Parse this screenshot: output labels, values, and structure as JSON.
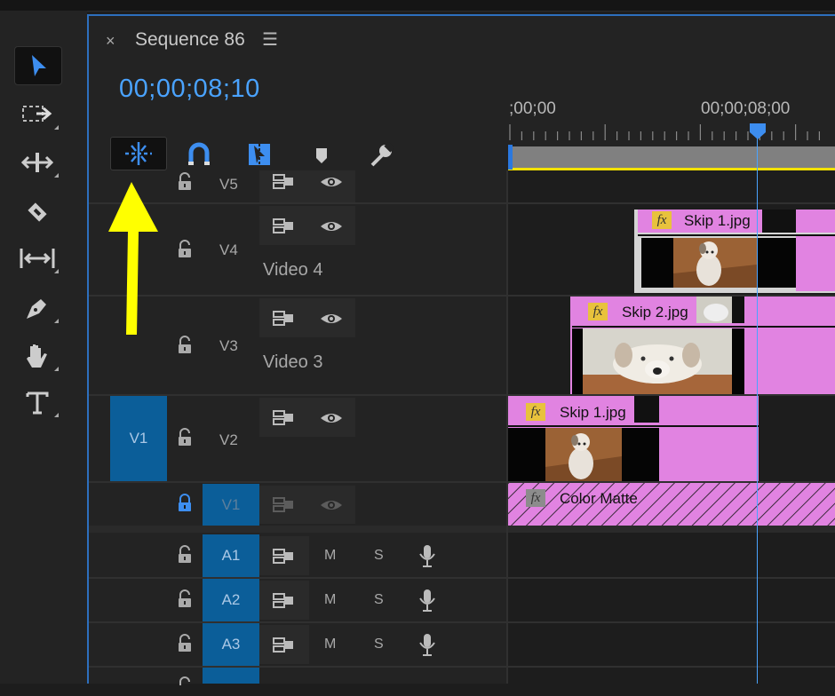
{
  "sequence": {
    "close_glyph": "×",
    "title": "Sequence 86",
    "menu_glyph": "☰",
    "timecode": "00;00;08;10"
  },
  "timeline_tools": [
    {
      "name": "snap-in-timeline-icon",
      "selected": true
    },
    {
      "name": "magnet-linked-selection-icon"
    },
    {
      "name": "insert-overwrite-icon"
    },
    {
      "name": "add-marker-icon"
    },
    {
      "name": "wrench-settings-icon"
    }
  ],
  "toolbar": [
    "selection-tool-icon",
    "track-select-forward-icon",
    "ripple-edit-icon",
    "razor-icon",
    "slip-icon",
    "pen-icon",
    "hand-icon",
    "type-icon"
  ],
  "ruler": {
    "start_label": ";00;00",
    "mark_label": "00;00;08;00"
  },
  "video_tracks": [
    {
      "id": "V5",
      "label": ""
    },
    {
      "id": "V4",
      "label": "Video 4"
    },
    {
      "id": "V3",
      "label": "Video 3"
    },
    {
      "id": "V2",
      "label": "",
      "source_patch": "V1"
    },
    {
      "id": "V1",
      "label": "",
      "locked": true
    }
  ],
  "audio_tracks": [
    {
      "id": "A1",
      "mute": "M",
      "solo": "S"
    },
    {
      "id": "A2",
      "mute": "M",
      "solo": "S"
    },
    {
      "id": "A3",
      "mute": "M",
      "solo": "S"
    }
  ],
  "clips": {
    "v4_clip": {
      "fx": "fx",
      "name": "Skip 1.jpg"
    },
    "v3_clip": {
      "fx": "fx",
      "name": "Skip 2.jpg"
    },
    "v2_clip": {
      "fx": "fx",
      "name": "Skip 1.jpg"
    },
    "v1_clip": {
      "fx": "fx",
      "name": "Color Matte"
    }
  },
  "colors": {
    "accent": "#4aa3ff",
    "clip_pink": "#e183e1",
    "patch_blue": "#0b5e99",
    "annotation_arrow": "#ffff00"
  }
}
